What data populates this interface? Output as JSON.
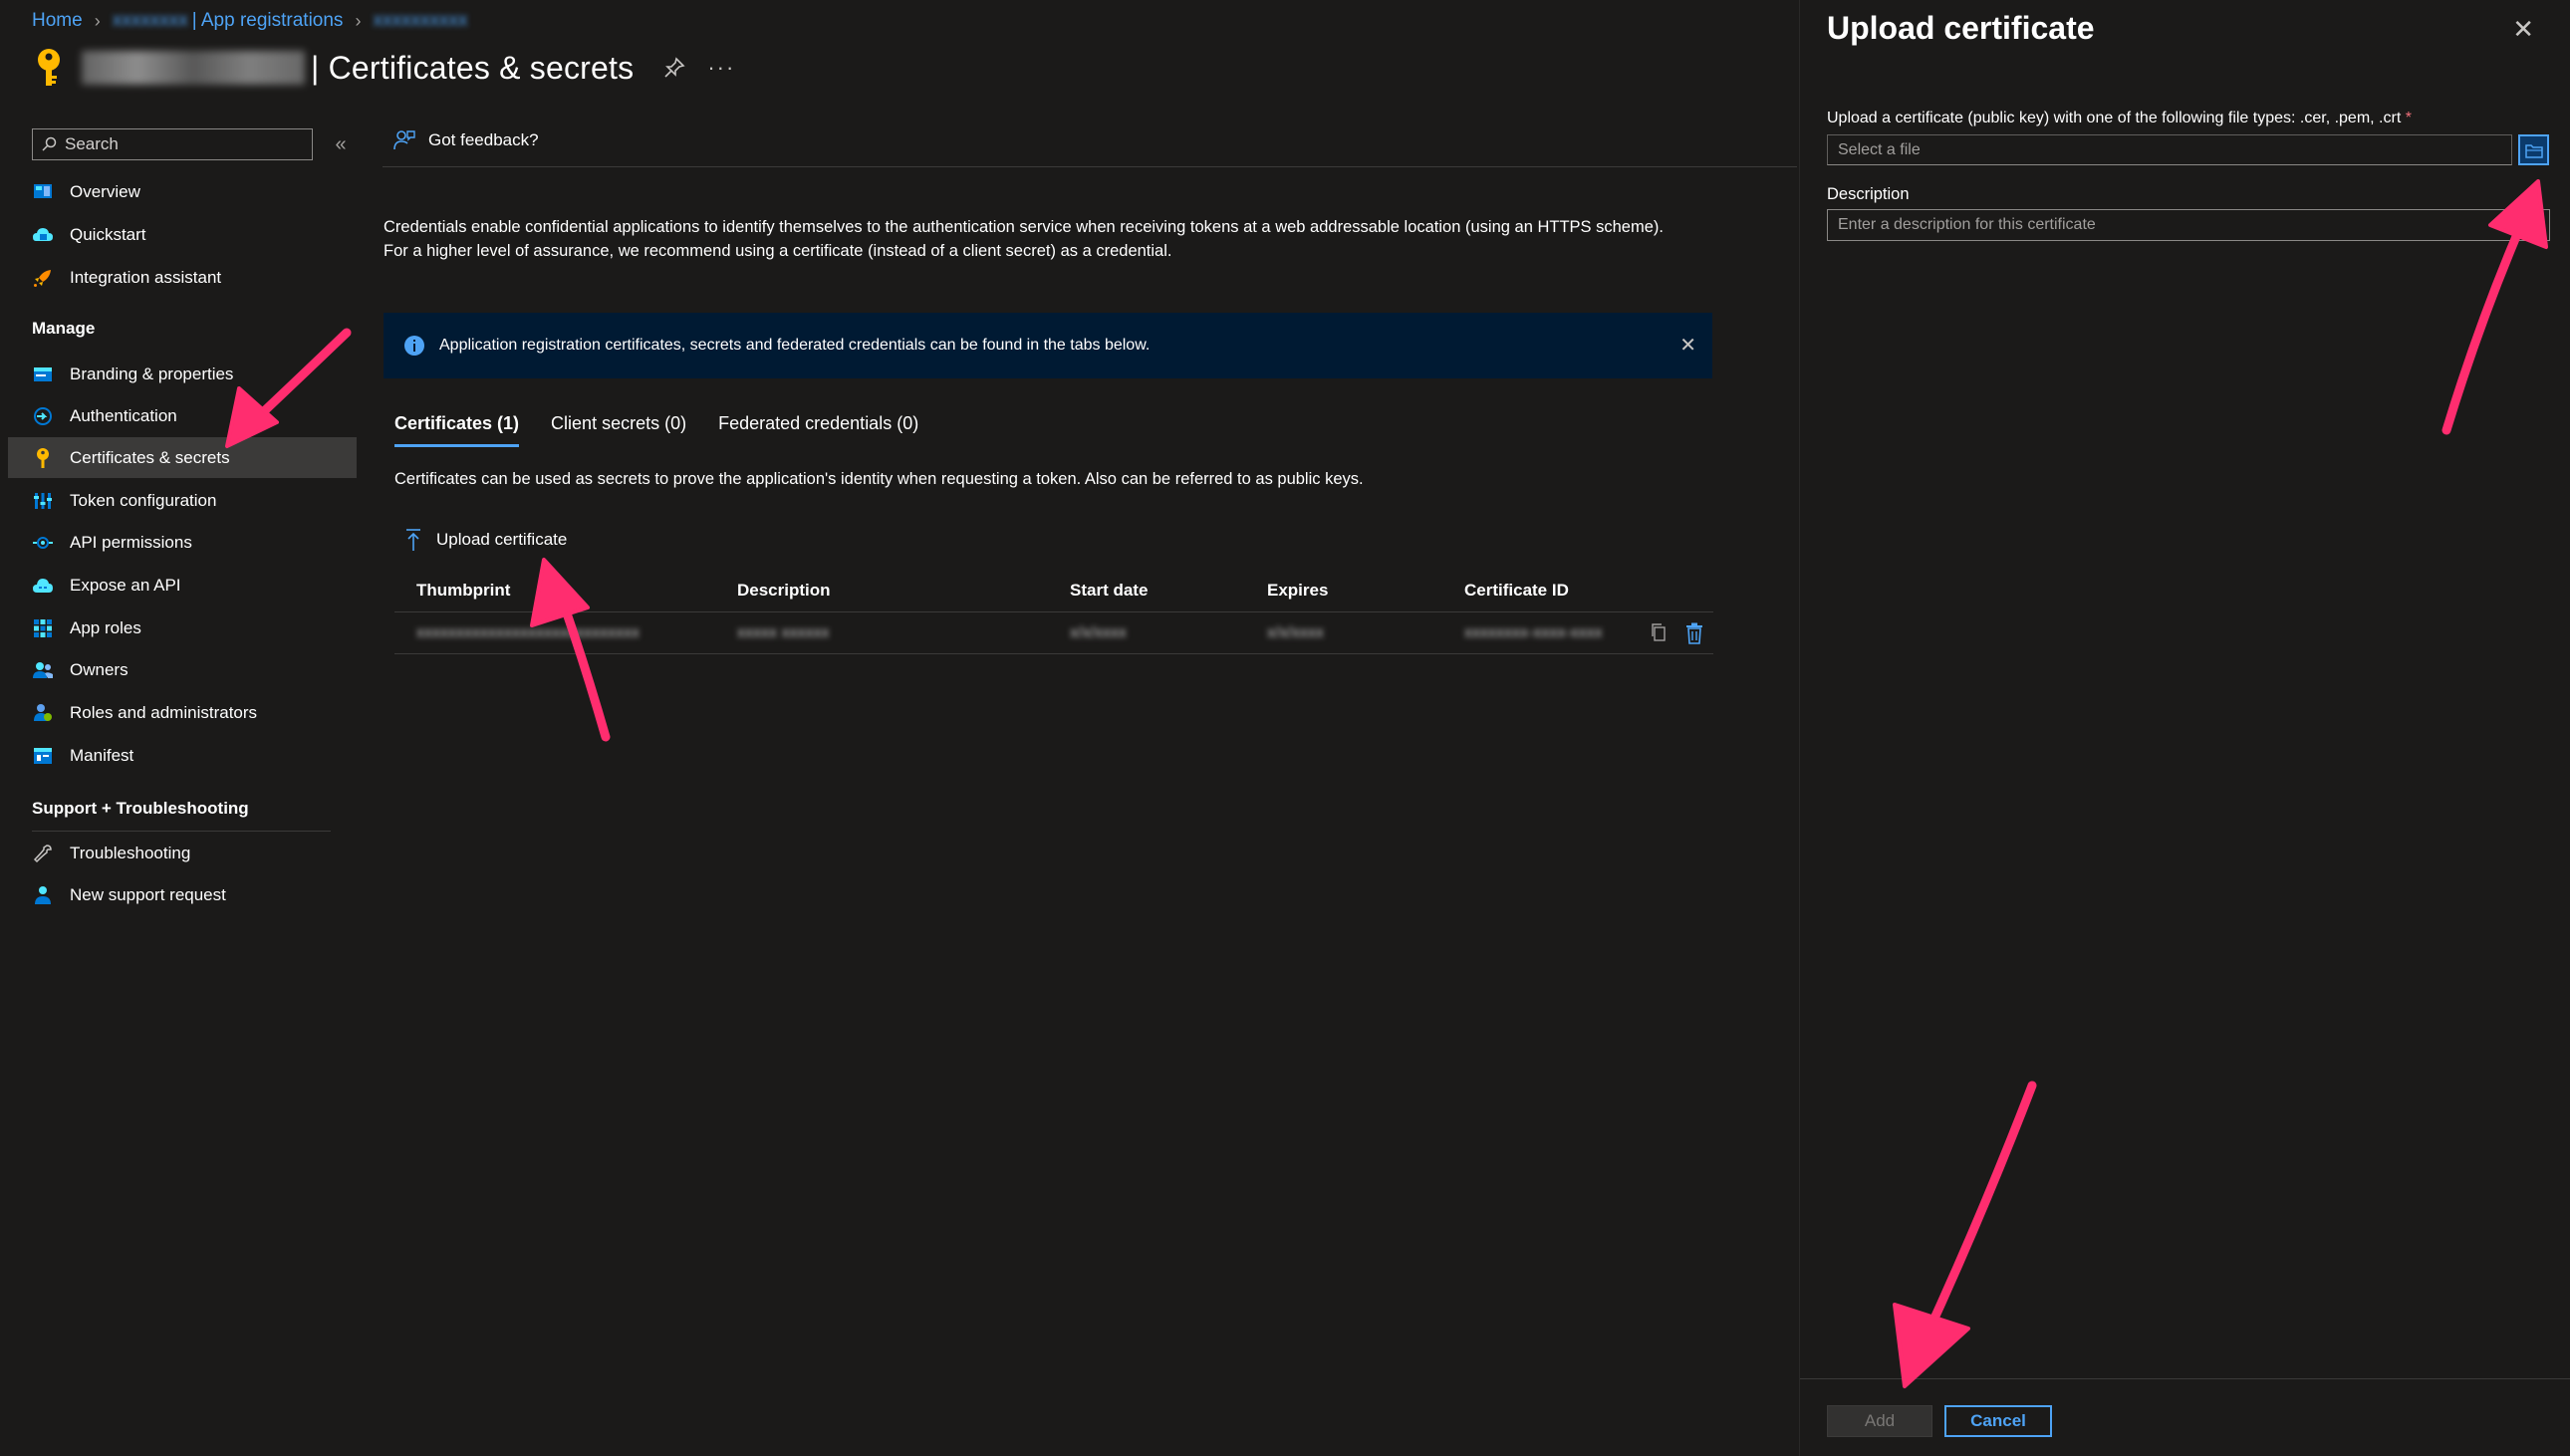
{
  "breadcrumb": {
    "home": "Home",
    "app_registrations": "| App registrations",
    "redacted_1": "xxxxxxxx",
    "redacted_2": "xxxxxxxxxx"
  },
  "page": {
    "title": "| Certificates & secrets",
    "more": "···"
  },
  "nav": {
    "search_placeholder": "Search",
    "collapse": "«",
    "items_top": [
      {
        "label": "Overview",
        "icon": "overview-icon"
      },
      {
        "label": "Quickstart",
        "icon": "quickstart-icon"
      },
      {
        "label": "Integration assistant",
        "icon": "rocket-icon"
      }
    ],
    "manage_heading": "Manage",
    "items_manage": [
      {
        "label": "Branding & properties",
        "icon": "branding-icon"
      },
      {
        "label": "Authentication",
        "icon": "authentication-icon"
      },
      {
        "label": "Certificates & secrets",
        "icon": "key-icon",
        "active": true
      },
      {
        "label": "Token configuration",
        "icon": "token-icon"
      },
      {
        "label": "API permissions",
        "icon": "api-permissions-icon"
      },
      {
        "label": "Expose an API",
        "icon": "cloud-icon"
      },
      {
        "label": "App roles",
        "icon": "app-roles-icon"
      },
      {
        "label": "Owners",
        "icon": "owners-icon"
      },
      {
        "label": "Roles and administrators",
        "icon": "roles-icon"
      },
      {
        "label": "Manifest",
        "icon": "manifest-icon"
      }
    ],
    "support_heading": "Support + Troubleshooting",
    "items_support": [
      {
        "label": "Troubleshooting",
        "icon": "wrench-icon"
      },
      {
        "label": "New support request",
        "icon": "support-person-icon"
      }
    ]
  },
  "main": {
    "feedback": "Got feedback?",
    "intro": "Credentials enable confidential applications to identify themselves to the authentication service when receiving tokens at a web addressable location (using an HTTPS scheme). For a higher level of assurance, we recommend using a certificate (instead of a client secret) as a credential.",
    "info_bar": "Application registration certificates, secrets and federated credentials can be found in the tabs below.",
    "tabs": [
      {
        "label": "Certificates (1)",
        "active": true
      },
      {
        "label": "Client secrets (0)"
      },
      {
        "label": "Federated credentials (0)"
      }
    ],
    "tab_description": "Certificates can be used as secrets to prove the application's identity when requesting a token. Also can be referred to as public keys.",
    "upload_label": "Upload certificate",
    "table": {
      "headers": [
        "Thumbprint",
        "Description",
        "Start date",
        "Expires",
        "Certificate ID"
      ],
      "rows": [
        [
          "xxxxxxxxxxxxxxxxxxxxxxxxxxxx",
          "xxxxx xxxxxx",
          "x/x/xxxx",
          "x/x/xxxx",
          "xxxxxxxx-xxxx-xxxx"
        ]
      ]
    }
  },
  "panel": {
    "title": "Upload certificate",
    "file_label": "Upload a certificate (public key) with one of the following file types: .cer, .pem, .crt",
    "required_mark": "*",
    "file_placeholder": "Select a file",
    "description_label": "Description",
    "description_placeholder": "Enter a description for this certificate",
    "add_button": "Add",
    "cancel_button": "Cancel"
  },
  "colors": {
    "accent": "#4ea3f5",
    "background": "#1b1a19",
    "info_bar": "#001a33",
    "annotation_arrow": "#ff2d6f"
  }
}
